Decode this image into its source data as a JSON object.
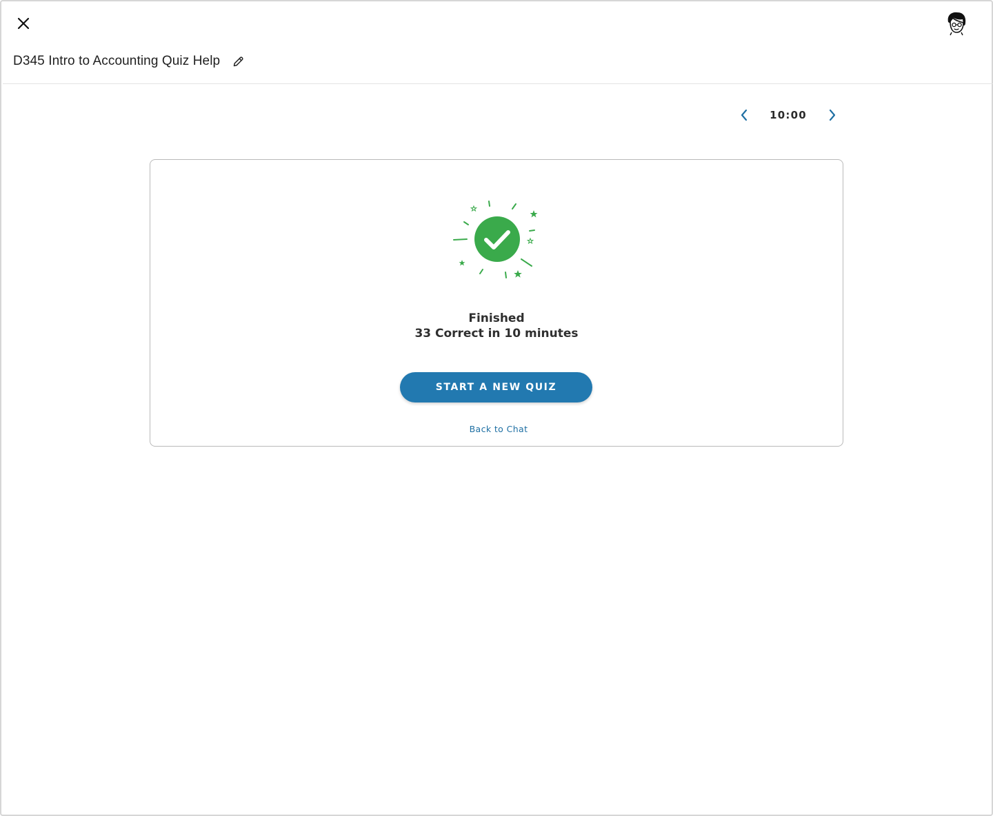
{
  "window": {
    "close_icon": "close-icon",
    "avatar_icon": "user-avatar-icon"
  },
  "header": {
    "title": "D345 Intro to Accounting Quiz Help",
    "edit_icon": "pencil-icon"
  },
  "timer": {
    "value": "10:00",
    "prev_icon": "chevron-left-icon",
    "next_icon": "chevron-right-icon"
  },
  "result": {
    "icon": "check-circle-icon",
    "title": "Finished",
    "summary": "33 Correct in 10 minutes",
    "primary_button": "START A NEW QUIZ",
    "back_link": "Back to Chat"
  },
  "colors": {
    "accent": "#2279b0",
    "success": "#3aaa4b",
    "link": "#1e6fa3"
  }
}
